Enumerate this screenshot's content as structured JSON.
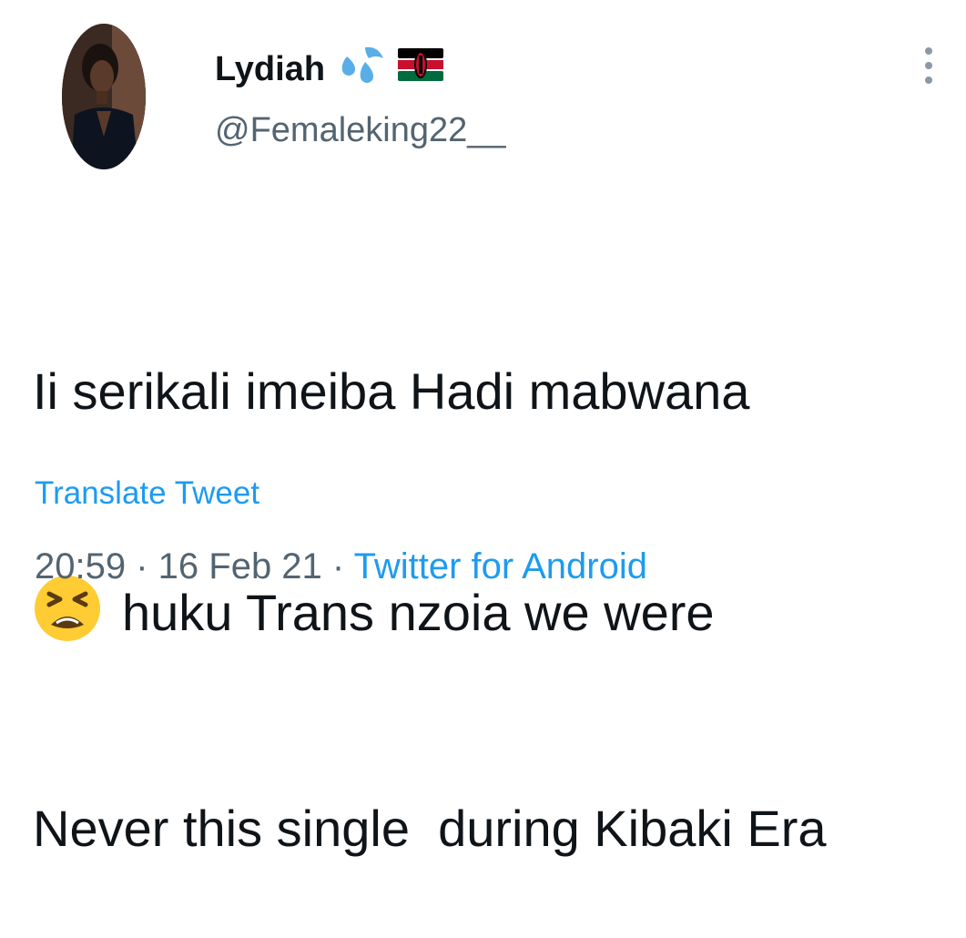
{
  "author": {
    "display_name": "Lydiah",
    "handle": "@Femaleking22__",
    "name_emojis": [
      "sweat-droplets-icon",
      "kenya-flag-icon"
    ]
  },
  "tweet": {
    "lines": [
      "Ii serikali imeiba Hadi mabwana",
      "huku Trans nzoia we were",
      "Never this single  during Kibaki Era"
    ],
    "inline_emoji": "tired-face-icon"
  },
  "translate_label": "Translate Tweet",
  "meta": {
    "time": "20:59",
    "separator": " · ",
    "date": "16 Feb 21",
    "source": "Twitter for Android"
  },
  "colors": {
    "link": "#1d9bf0",
    "secondary_text": "#536471",
    "primary_text": "#0f1419"
  }
}
